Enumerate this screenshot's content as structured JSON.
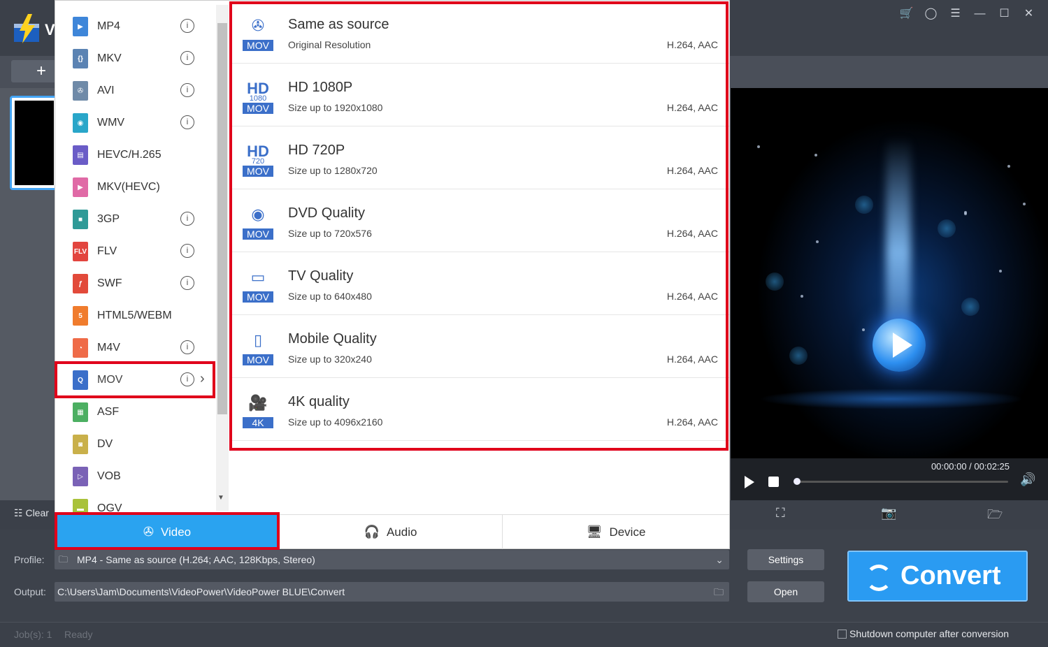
{
  "window": {
    "app_initial": "V",
    "controls": [
      "cart-icon",
      "user-icon",
      "menu-icon",
      "minimize-icon",
      "maximize-icon",
      "close-icon"
    ]
  },
  "toolbar": {
    "add_label": "+"
  },
  "format_list": {
    "items": [
      {
        "name": "MP4",
        "info": true,
        "color": "#3e86d9",
        "glyph": "▶"
      },
      {
        "name": "MKV",
        "info": true,
        "color": "#5b83b3",
        "glyph": "{}"
      },
      {
        "name": "AVI",
        "info": true,
        "color": "#6f8aa8",
        "glyph": "✇"
      },
      {
        "name": "WMV",
        "info": true,
        "color": "#29a6c9",
        "glyph": "◉"
      },
      {
        "name": "HEVC/H.265",
        "info": false,
        "color": "#6a5cc7",
        "glyph": "▤"
      },
      {
        "name": "MKV(HEVC)",
        "info": false,
        "color": "#e06aa6",
        "glyph": "▶"
      },
      {
        "name": "3GP",
        "info": true,
        "color": "#2f9a97",
        "glyph": "■"
      },
      {
        "name": "FLV",
        "info": true,
        "color": "#e2453f",
        "glyph": "FLV"
      },
      {
        "name": "SWF",
        "info": true,
        "color": "#e24a3a",
        "glyph": "ƒ"
      },
      {
        "name": "HTML5/WEBM",
        "info": false,
        "color": "#f07c2d",
        "glyph": "5"
      },
      {
        "name": "M4V",
        "info": true,
        "color": "#ef6b48",
        "glyph": "◔"
      },
      {
        "name": "MOV",
        "info": true,
        "color": "#3b6fc9",
        "glyph": "Q"
      },
      {
        "name": "ASF",
        "info": false,
        "color": "#4caf62",
        "glyph": "▦"
      },
      {
        "name": "DV",
        "info": false,
        "color": "#c9b04a",
        "glyph": "◙"
      },
      {
        "name": "VOB",
        "info": false,
        "color": "#7a62b6",
        "glyph": "▷"
      },
      {
        "name": "OGV",
        "info": false,
        "color": "#a9c23a",
        "glyph": "▬"
      }
    ],
    "selected": "MOV"
  },
  "profiles": [
    {
      "title": "Same as source",
      "subtitle": "Original Resolution",
      "codec": "H.264, AAC",
      "icon_sym": "✇",
      "tag": "MOV"
    },
    {
      "title": "HD 1080P",
      "subtitle": "Size up to 1920x1080",
      "codec": "H.264, AAC",
      "icon_sym": "HD",
      "icon_sub": "1080",
      "tag": "MOV"
    },
    {
      "title": "HD 720P",
      "subtitle": "Size up to 1280x720",
      "codec": "H.264, AAC",
      "icon_sym": "HD",
      "icon_sub": "720",
      "tag": "MOV"
    },
    {
      "title": "DVD Quality",
      "subtitle": "Size up to 720x576",
      "codec": "H.264, AAC",
      "icon_sym": "◉",
      "tag": "MOV"
    },
    {
      "title": "TV Quality",
      "subtitle": "Size up to 640x480",
      "codec": "H.264, AAC",
      "icon_sym": "▭",
      "tag": "MOV"
    },
    {
      "title": "Mobile Quality",
      "subtitle": "Size up to 320x240",
      "codec": "H.264, AAC",
      "icon_sym": "▯",
      "tag": "MOV"
    },
    {
      "title": "4K quality",
      "subtitle": "Size up to 4096x2160",
      "codec": "H.264, AAC",
      "icon_sym": "🎥",
      "tag": "4K"
    }
  ],
  "tabs": {
    "video": "Video",
    "audio": "Audio",
    "device": "Device",
    "active": "Video"
  },
  "player": {
    "time": "00:00:00 / 00:02:25",
    "progress": 0.0
  },
  "actions": {
    "clear": "Clear"
  },
  "bottom": {
    "profile_label": "Profile:",
    "profile_value": "MP4 - Same as source (H.264; AAC, 128Kbps, Stereo)",
    "output_label": "Output:",
    "output_value": "C:\\Users\\Jam\\Documents\\VideoPower\\VideoPower BLUE\\Convert",
    "settings": "Settings",
    "open": "Open",
    "convert": "Convert"
  },
  "status": {
    "jobs": "Job(s): 1",
    "state": "Ready",
    "shutdown": "Shutdown computer after conversion"
  },
  "colors": {
    "accent": "#2aa3f0",
    "highlight": "#e0001b",
    "mov_blue": "#3b6fc9"
  }
}
